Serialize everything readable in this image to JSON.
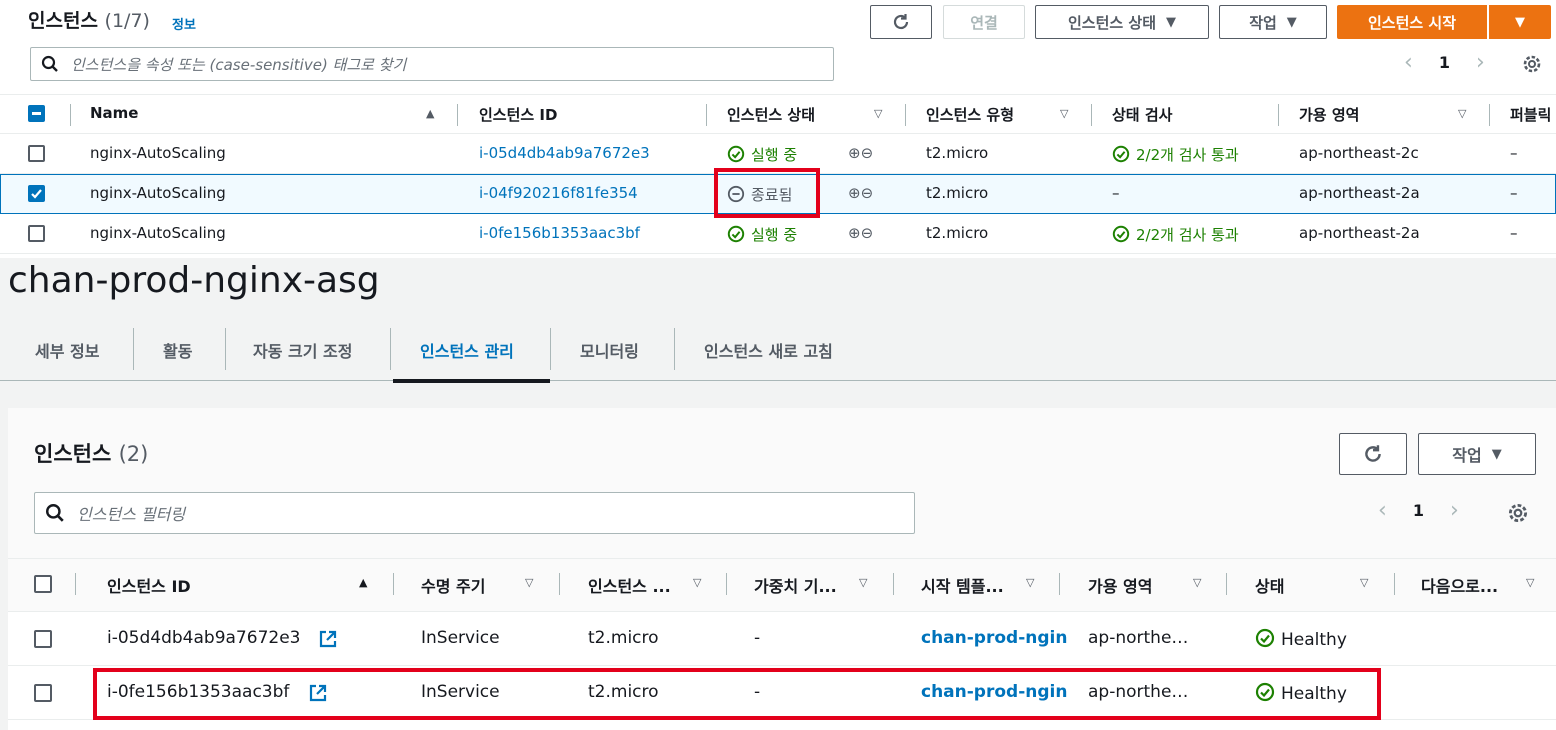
{
  "top": {
    "title": "인스턴스",
    "count": "(1/7)",
    "info_link": "정보",
    "buttons": {
      "connect": "연결",
      "instance_state": "인스턴스 상태",
      "actions": "작업",
      "launch": "인스턴스 시작"
    },
    "search_placeholder": "인스턴스을 속성 또는 (case-sensitive) 태그로 찾기",
    "page": "1",
    "columns": [
      "Name",
      "인스턴스 ID",
      "인스턴스 상태",
      "인스턴스 유형",
      "상태 검사",
      "가용 영역",
      "퍼블릭"
    ],
    "rows": [
      {
        "name": "nginx-AutoScaling",
        "id": "i-05d4db4ab9a7672e3",
        "state": "실행 중",
        "type": "t2.micro",
        "check": "2/2개 검사 통과",
        "az": "ap-northeast-2c",
        "public": "–",
        "selected": false
      },
      {
        "name": "nginx-AutoScaling",
        "id": "i-04f920216f81fe354",
        "state": "종료됨",
        "type": "t2.micro",
        "check": "–",
        "az": "ap-northeast-2a",
        "public": "–",
        "selected": true
      },
      {
        "name": "nginx-AutoScaling",
        "id": "i-0fe156b1353aac3bf",
        "state": "실행 중",
        "type": "t2.micro",
        "check": "2/2개 검사 통과",
        "az": "ap-northeast-2a",
        "public": "–",
        "selected": false
      }
    ]
  },
  "asg": {
    "name": "chan-prod-nginx-asg",
    "tabs": [
      "세부 정보",
      "활동",
      "자동 크기 조정",
      "인스턴스 관리",
      "모니터링",
      "인스턴스 새로 고침"
    ],
    "active_tab": "인스턴스 관리",
    "panel": {
      "title": "인스턴스",
      "count": "(2)",
      "actions": "작업",
      "search_placeholder": "인스턴스 필터링",
      "page": "1",
      "columns": [
        "인스턴스 ID",
        "수명 주기",
        "인스턴스 ...",
        "가중치 기...",
        "시작 템플...",
        "가용 영역",
        "상태",
        "다음으로..."
      ],
      "rows": [
        {
          "id": "i-05d4db4ab9a7672e3",
          "lifecycle": "InService",
          "type": "t2.micro",
          "weight": "-",
          "template": "chan-prod-ngin",
          "az": "ap-northe…",
          "health": "Healthy"
        },
        {
          "id": "i-0fe156b1353aac3bf",
          "lifecycle": "InService",
          "type": "t2.micro",
          "weight": "-",
          "template": "chan-prod-ngin",
          "az": "ap-northe…",
          "health": "Healthy"
        }
      ]
    }
  },
  "colors": {
    "link": "#0073bb",
    "success": "#1d8102",
    "primary": "#ec7211",
    "highlight": "#e3001b"
  }
}
